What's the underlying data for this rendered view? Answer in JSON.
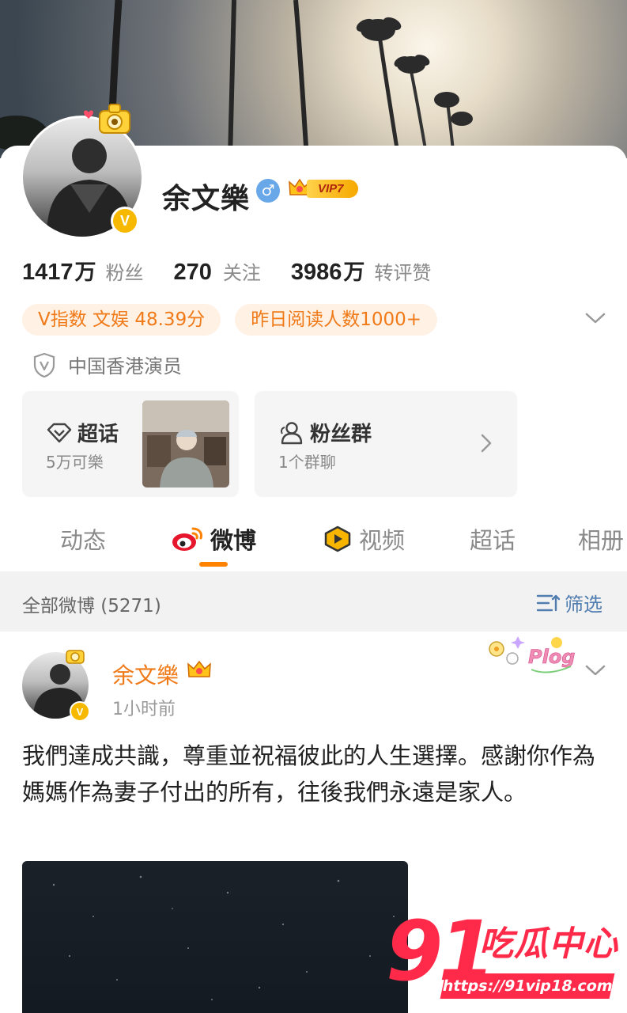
{
  "profile": {
    "name": "余文樂",
    "gender_symbol": "♂",
    "verified_badge": "V",
    "vip_label": "VIP7"
  },
  "stats": [
    {
      "num": "1417",
      "unit": "万",
      "label": "粉丝"
    },
    {
      "num": "270",
      "unit": "",
      "label": "关注"
    },
    {
      "num": "3986",
      "unit": "万",
      "label": "转评赞"
    }
  ],
  "tags": {
    "v_index": "V指数 文娱 48.39分",
    "reads": "昨日阅读人数1000+"
  },
  "certification": "中国香港演员",
  "cards": {
    "supertopic": {
      "title": "超话",
      "sub": "5万可樂"
    },
    "fan_group": {
      "title": "粉丝群",
      "sub": "1个群聊"
    }
  },
  "tabs": [
    "动态",
    "微博",
    "视频",
    "超话",
    "相册"
  ],
  "active_tab": "微博",
  "filter_bar": {
    "all_label": "全部微博 (5271)",
    "filter_label": "筛选"
  },
  "post": {
    "author": "余文樂",
    "verified_badge": "V",
    "time": "1小时前",
    "sticker_text": "Plog",
    "text": "我們達成共識，尊重並祝福彼此的人生選擇。感謝你作為媽媽作為妻子付出的所有，往後我們永遠是家人。"
  },
  "watermark": {
    "number": "91",
    "text": "吃瓜中心",
    "url": "https://91vip18.com"
  },
  "colors": {
    "accent_orange": "#ff8200",
    "tag_text": "#f07a18",
    "tag_bg": "#fff1e4",
    "link_blue": "#507daf",
    "watermark_red": "#ff2a49"
  }
}
